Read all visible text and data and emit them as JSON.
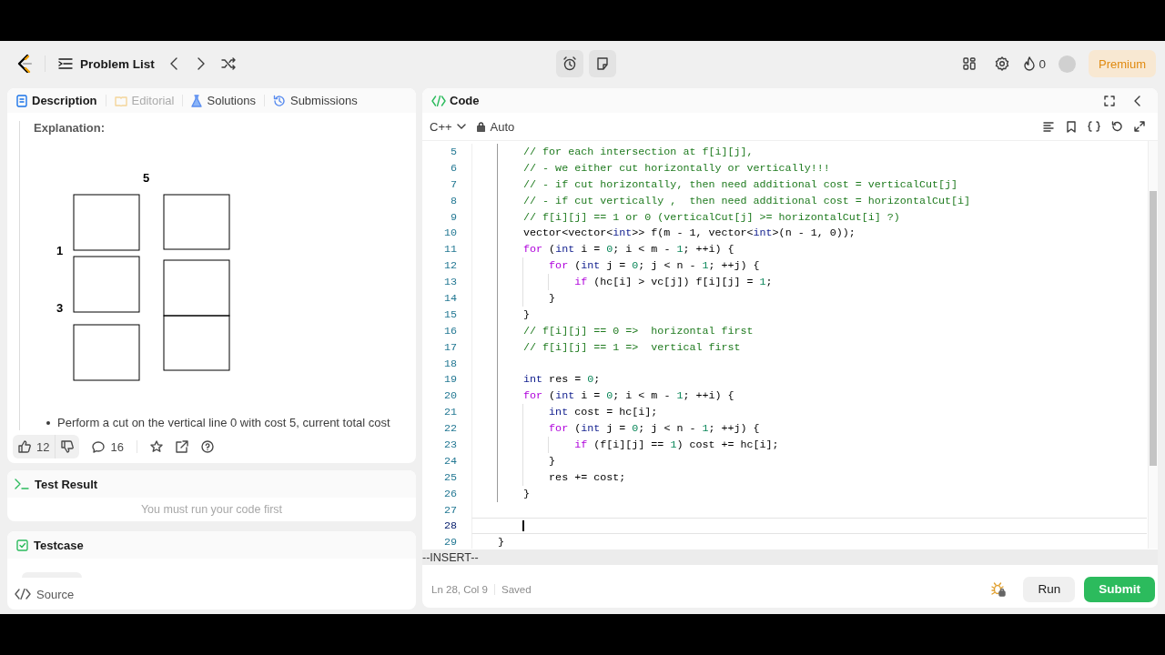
{
  "nav": {
    "problem_list": "Problem List",
    "timer_selected": true,
    "streak": "0",
    "premium": "Premium"
  },
  "left_tabs": [
    {
      "label": "Description",
      "selected": true,
      "disabled": false
    },
    {
      "label": "Editorial",
      "selected": false,
      "disabled": true
    },
    {
      "label": "Solutions",
      "selected": false,
      "disabled": false
    },
    {
      "label": "Submissions",
      "selected": false,
      "disabled": false
    }
  ],
  "description": {
    "heading": "Explanation:",
    "diagram_labels": [
      "5",
      "1",
      "3"
    ],
    "bullet": "Perform a cut on the vertical line 0 with cost 5, current total cost"
  },
  "actions": {
    "likes": "12",
    "comments": "16"
  },
  "test_result": {
    "title": "Test Result",
    "message": "You must run your code first"
  },
  "testcase": {
    "title": "Testcase",
    "source": "Source"
  },
  "code": {
    "title": "Code",
    "language": "C++",
    "mode": "Auto",
    "lines": [
      {
        "number": "5",
        "active": false,
        "tokens": [
          {
            "kind": "comment",
            "text": "    // for each intersection at f[i][j],"
          }
        ]
      },
      {
        "number": "6",
        "active": false,
        "tokens": [
          {
            "kind": "comment",
            "text": "    // - we either cut horizontally or vertically!!!"
          }
        ]
      },
      {
        "number": "7",
        "active": false,
        "tokens": [
          {
            "kind": "comment",
            "text": "    // - if cut horizontally, then need additional cost = verticalCut[j]"
          }
        ]
      },
      {
        "number": "8",
        "active": false,
        "tokens": [
          {
            "kind": "comment",
            "text": "    // - if cut vertically ,  then need additional cost = horizontalCut[i]"
          }
        ]
      },
      {
        "number": "9",
        "active": false,
        "tokens": [
          {
            "kind": "comment",
            "text": "    // f[i][j] == 1 or 0 (verticalCut[j] >= horizontalCut[i] ?)"
          }
        ]
      },
      {
        "number": "10",
        "active": false,
        "tokens": [
          {
            "kind": "plain",
            "text": "    vector<vector<"
          },
          {
            "kind": "type",
            "text": "int"
          },
          {
            "kind": "plain",
            "text": ">> f(m - 1, vector<"
          },
          {
            "kind": "type",
            "text": "int"
          },
          {
            "kind": "plain",
            "text": ">(n - 1, 0));"
          }
        ]
      },
      {
        "number": "11",
        "active": false,
        "tokens": [
          {
            "kind": "keyword",
            "text": "    for"
          },
          {
            "kind": "plain",
            "text": " ("
          },
          {
            "kind": "type",
            "text": "int"
          },
          {
            "kind": "plain",
            "text": " i = "
          },
          {
            "kind": "number",
            "text": "0"
          },
          {
            "kind": "plain",
            "text": "; i < m - "
          },
          {
            "kind": "number",
            "text": "1"
          },
          {
            "kind": "plain",
            "text": "; ++i) {"
          }
        ]
      },
      {
        "number": "12",
        "active": false,
        "tokens": [
          {
            "kind": "keyword",
            "text": "        for"
          },
          {
            "kind": "plain",
            "text": " ("
          },
          {
            "kind": "type",
            "text": "int"
          },
          {
            "kind": "plain",
            "text": " j = "
          },
          {
            "kind": "number",
            "text": "0"
          },
          {
            "kind": "plain",
            "text": "; j < n - "
          },
          {
            "kind": "number",
            "text": "1"
          },
          {
            "kind": "plain",
            "text": "; ++j) {"
          }
        ]
      },
      {
        "number": "13",
        "active": false,
        "tokens": [
          {
            "kind": "keyword",
            "text": "            if"
          },
          {
            "kind": "plain",
            "text": " (hc[i] > vc[j]) f[i][j] = "
          },
          {
            "kind": "number",
            "text": "1"
          },
          {
            "kind": "plain",
            "text": ";"
          }
        ]
      },
      {
        "number": "14",
        "active": false,
        "tokens": [
          {
            "kind": "plain",
            "text": "        }"
          }
        ]
      },
      {
        "number": "15",
        "active": false,
        "tokens": [
          {
            "kind": "plain",
            "text": "    }"
          }
        ]
      },
      {
        "number": "16",
        "active": false,
        "tokens": [
          {
            "kind": "comment",
            "text": "    // f[i][j] == 0 =>  horizontal first"
          }
        ]
      },
      {
        "number": "17",
        "active": false,
        "tokens": [
          {
            "kind": "comment",
            "text": "    // f[i][j] == 1 =>  vertical first"
          }
        ]
      },
      {
        "number": "18",
        "active": false
      },
      {
        "number": "19",
        "active": false,
        "tokens": [
          {
            "kind": "type",
            "text": "    int"
          },
          {
            "kind": "plain",
            "text": " res = "
          },
          {
            "kind": "number",
            "text": "0"
          },
          {
            "kind": "plain",
            "text": ";"
          }
        ]
      },
      {
        "number": "20",
        "active": false,
        "tokens": [
          {
            "kind": "keyword",
            "text": "    for"
          },
          {
            "kind": "plain",
            "text": " ("
          },
          {
            "kind": "type",
            "text": "int"
          },
          {
            "kind": "plain",
            "text": " i = "
          },
          {
            "kind": "number",
            "text": "0"
          },
          {
            "kind": "plain",
            "text": "; i < m - "
          },
          {
            "kind": "number",
            "text": "1"
          },
          {
            "kind": "plain",
            "text": "; ++i) {"
          }
        ]
      },
      {
        "number": "21",
        "active": false,
        "tokens": [
          {
            "kind": "type",
            "text": "        int"
          },
          {
            "kind": "plain",
            "text": " cost = hc[i];"
          }
        ]
      },
      {
        "number": "22",
        "active": false,
        "tokens": [
          {
            "kind": "keyword",
            "text": "        for"
          },
          {
            "kind": "plain",
            "text": " ("
          },
          {
            "kind": "type",
            "text": "int"
          },
          {
            "kind": "plain",
            "text": " j = "
          },
          {
            "kind": "number",
            "text": "0"
          },
          {
            "kind": "plain",
            "text": "; j < n - "
          },
          {
            "kind": "number",
            "text": "1"
          },
          {
            "kind": "plain",
            "text": "; ++j) {"
          }
        ]
      },
      {
        "number": "23",
        "active": false,
        "tokens": [
          {
            "kind": "keyword",
            "text": "            if"
          },
          {
            "kind": "plain",
            "text": " (f[i][j] == "
          },
          {
            "kind": "number",
            "text": "1"
          },
          {
            "kind": "plain",
            "text": ") cost += hc[i];"
          }
        ]
      },
      {
        "number": "24",
        "active": false,
        "tokens": [
          {
            "kind": "plain",
            "text": "        }"
          }
        ]
      },
      {
        "number": "25",
        "active": false,
        "tokens": [
          {
            "kind": "plain",
            "text": "        res += cost;"
          }
        ]
      },
      {
        "number": "26",
        "active": false,
        "tokens": [
          {
            "kind": "plain",
            "text": "    }"
          }
        ]
      },
      {
        "number": "27",
        "active": false
      },
      {
        "number": "28",
        "active": true
      },
      {
        "number": "29",
        "active": false,
        "tokens": [
          {
            "kind": "plain",
            "text": "}"
          }
        ]
      }
    ]
  },
  "status": {
    "mode": "--INSERT--",
    "position": "Ln 28, Col 9",
    "saved": "Saved"
  },
  "buttons": {
    "run": "Run",
    "submit": "Submit"
  }
}
